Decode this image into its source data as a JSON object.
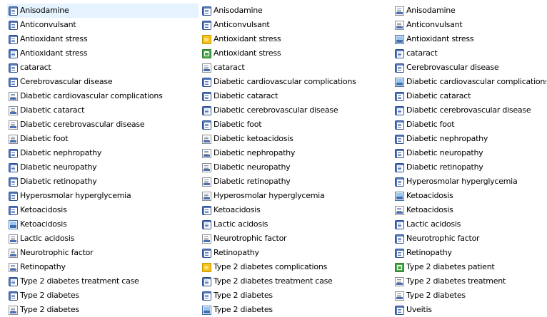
{
  "columns": [
    {
      "items": [
        {
          "label": "Anisodamine",
          "icon": "word-document-icon",
          "selected": true
        },
        {
          "label": "Anticonvulsant",
          "icon": "word-document-icon"
        },
        {
          "label": "Antioxidant stress",
          "icon": "word-document-icon"
        },
        {
          "label": "Antioxidant stress",
          "icon": "word-document-icon"
        },
        {
          "label": "cataract",
          "icon": "word-document-icon"
        },
        {
          "label": "Cerebrovascular disease",
          "icon": "word-document-icon"
        },
        {
          "label": "Diabetic cardiovascular complications",
          "icon": "document-icon"
        },
        {
          "label": "Diabetic cataract",
          "icon": "document-icon"
        },
        {
          "label": "Diabetic cerebrovascular disease",
          "icon": "document-icon"
        },
        {
          "label": "Diabetic foot",
          "icon": "document-icon"
        },
        {
          "label": "Diabetic nephropathy",
          "icon": "word-document-icon"
        },
        {
          "label": "Diabetic neuropathy",
          "icon": "word-document-icon"
        },
        {
          "label": "Diabetic retinopathy",
          "icon": "word-document-icon"
        },
        {
          "label": "Hyperosmolar hyperglycemia",
          "icon": "word-document-icon"
        },
        {
          "label": "Ketoacidosis",
          "icon": "word-document-icon"
        },
        {
          "label": "Ketoacidosis",
          "icon": "picture-icon"
        },
        {
          "label": "Lactic acidosis",
          "icon": "document-icon"
        },
        {
          "label": "Neurotrophic factor",
          "icon": "document-icon"
        },
        {
          "label": "Retinopathy",
          "icon": "document-icon"
        },
        {
          "label": "Type 2 diabetes treatment case",
          "icon": "word-document-icon"
        },
        {
          "label": "Type 2 diabetes",
          "icon": "word-document-icon"
        },
        {
          "label": "Type 2 diabetes",
          "icon": "document-icon"
        }
      ]
    },
    {
      "items": [
        {
          "label": "Anisodamine",
          "icon": "word-document-icon"
        },
        {
          "label": "Anticonvulsant",
          "icon": "word-document-icon"
        },
        {
          "label": "Antioxidant stress",
          "icon": "image-yellow-icon"
        },
        {
          "label": "Antioxidant stress",
          "icon": "image-green-icon"
        },
        {
          "label": "cataract",
          "icon": "document-icon"
        },
        {
          "label": "Diabetic cardiovascular complications",
          "icon": "word-document-icon"
        },
        {
          "label": "Diabetic cataract",
          "icon": "word-document-icon"
        },
        {
          "label": "Diabetic cerebrovascular disease",
          "icon": "word-document-icon"
        },
        {
          "label": "Diabetic foot",
          "icon": "word-document-icon"
        },
        {
          "label": "Diabetic ketoacidosis",
          "icon": "document-icon"
        },
        {
          "label": "Diabetic nephropathy",
          "icon": "document-icon"
        },
        {
          "label": "Diabetic neuropathy",
          "icon": "document-icon"
        },
        {
          "label": "Diabetic retinopathy",
          "icon": "document-icon"
        },
        {
          "label": "Hyperosmolar hyperglycemia",
          "icon": "document-icon"
        },
        {
          "label": "Ketoacidosis",
          "icon": "word-document-icon"
        },
        {
          "label": "Lactic acidosis",
          "icon": "word-document-icon"
        },
        {
          "label": "Neurotrophic factor",
          "icon": "document-icon"
        },
        {
          "label": "Retinopathy",
          "icon": "word-document-icon"
        },
        {
          "label": "Type 2 diabetes complications",
          "icon": "image-yellow-icon"
        },
        {
          "label": "Type 2 diabetes treatment case",
          "icon": "word-document-icon"
        },
        {
          "label": "Type 2 diabetes",
          "icon": "word-document-icon"
        },
        {
          "label": "Type 2 diabetes",
          "icon": "picture-icon"
        }
      ]
    },
    {
      "items": [
        {
          "label": "Anisodamine",
          "icon": "document-icon"
        },
        {
          "label": "Anticonvulsant",
          "icon": "document-icon"
        },
        {
          "label": "Antioxidant stress",
          "icon": "picture-icon"
        },
        {
          "label": "cataract",
          "icon": "word-document-icon"
        },
        {
          "label": "Cerebrovascular disease",
          "icon": "word-document-icon"
        },
        {
          "label": "Diabetic cardiovascular complications",
          "icon": "picture-icon"
        },
        {
          "label": "Diabetic cataract",
          "icon": "word-document-icon"
        },
        {
          "label": "Diabetic cerebrovascular disease",
          "icon": "word-document-icon"
        },
        {
          "label": "Diabetic foot",
          "icon": "word-document-icon"
        },
        {
          "label": "Diabetic nephropathy",
          "icon": "word-document-icon"
        },
        {
          "label": "Diabetic neuropathy",
          "icon": "word-document-icon"
        },
        {
          "label": "Diabetic retinopathy",
          "icon": "word-document-icon"
        },
        {
          "label": "Hyperosmolar hyperglycemia",
          "icon": "word-document-icon"
        },
        {
          "label": "Ketoacidosis",
          "icon": "picture-icon"
        },
        {
          "label": "Ketoacidosis",
          "icon": "document-icon"
        },
        {
          "label": "Lactic acidosis",
          "icon": "word-document-icon"
        },
        {
          "label": "Neurotrophic factor",
          "icon": "word-document-icon"
        },
        {
          "label": "Retinopathy",
          "icon": "word-document-icon"
        },
        {
          "label": "Type 2 diabetes patient",
          "icon": "image-green-icon"
        },
        {
          "label": "Type 2 diabetes treatment",
          "icon": "document-icon"
        },
        {
          "label": "Type 2 diabetes",
          "icon": "document-icon"
        },
        {
          "label": "Uveitis",
          "icon": "word-document-icon"
        }
      ]
    }
  ],
  "colors": {
    "selection_bg": "#e5f3ff",
    "text": "#000000",
    "background": "#ffffff"
  }
}
